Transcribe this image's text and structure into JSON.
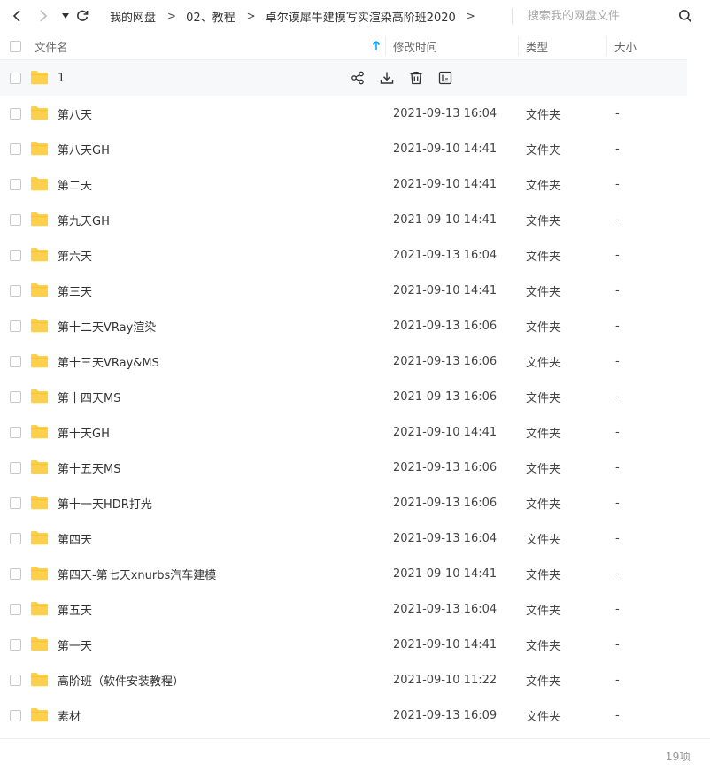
{
  "breadcrumb": {
    "items": [
      "我的网盘",
      "02、教程",
      "卓尔谟犀牛建模写实渲染高阶班2020"
    ],
    "separator": ">"
  },
  "search": {
    "placeholder": "搜索我的网盘文件"
  },
  "table": {
    "columns": {
      "name": "文件名",
      "modified": "修改时间",
      "type": "类型",
      "size": "大小"
    },
    "rows": [
      {
        "name": "1",
        "modified": "",
        "type": "",
        "size": ""
      },
      {
        "name": "第八天",
        "modified": "2021-09-13 16:04",
        "type": "文件夹",
        "size": "-"
      },
      {
        "name": "第八天GH",
        "modified": "2021-09-10 14:41",
        "type": "文件夹",
        "size": "-"
      },
      {
        "name": "第二天",
        "modified": "2021-09-10 14:41",
        "type": "文件夹",
        "size": "-"
      },
      {
        "name": "第九天GH",
        "modified": "2021-09-10 14:41",
        "type": "文件夹",
        "size": "-"
      },
      {
        "name": "第六天",
        "modified": "2021-09-13 16:04",
        "type": "文件夹",
        "size": "-"
      },
      {
        "name": "第三天",
        "modified": "2021-09-10 14:41",
        "type": "文件夹",
        "size": "-"
      },
      {
        "name": "第十二天VRay渲染",
        "modified": "2021-09-13 16:06",
        "type": "文件夹",
        "size": "-"
      },
      {
        "name": "第十三天VRay&MS",
        "modified": "2021-09-13 16:06",
        "type": "文件夹",
        "size": "-"
      },
      {
        "name": "第十四天MS",
        "modified": "2021-09-13 16:06",
        "type": "文件夹",
        "size": "-"
      },
      {
        "name": "第十天GH",
        "modified": "2021-09-10 14:41",
        "type": "文件夹",
        "size": "-"
      },
      {
        "name": "第十五天MS",
        "modified": "2021-09-13 16:06",
        "type": "文件夹",
        "size": "-"
      },
      {
        "name": "第十一天HDR打光",
        "modified": "2021-09-13 16:06",
        "type": "文件夹",
        "size": "-"
      },
      {
        "name": "第四天",
        "modified": "2021-09-13 16:04",
        "type": "文件夹",
        "size": "-"
      },
      {
        "name": "第四天-第七天xnurbs汽车建模",
        "modified": "2021-09-10 14:41",
        "type": "文件夹",
        "size": "-"
      },
      {
        "name": "第五天",
        "modified": "2021-09-13 16:04",
        "type": "文件夹",
        "size": "-"
      },
      {
        "name": "第一天",
        "modified": "2021-09-10 14:41",
        "type": "文件夹",
        "size": "-"
      },
      {
        "name": "高阶班（软件安装教程）",
        "modified": "2021-09-10 11:22",
        "type": "文件夹",
        "size": "-"
      },
      {
        "name": "素材",
        "modified": "2021-09-13 16:09",
        "type": "文件夹",
        "size": "-"
      }
    ]
  },
  "row_actions": [
    "share-icon",
    "download-icon",
    "delete-icon",
    "rename-icon"
  ],
  "footer": {
    "count": "19项"
  },
  "colors": {
    "folder": "#FFD04B",
    "sort_arrow": "#06a7ff",
    "hover_row": "#f7f8fa"
  }
}
